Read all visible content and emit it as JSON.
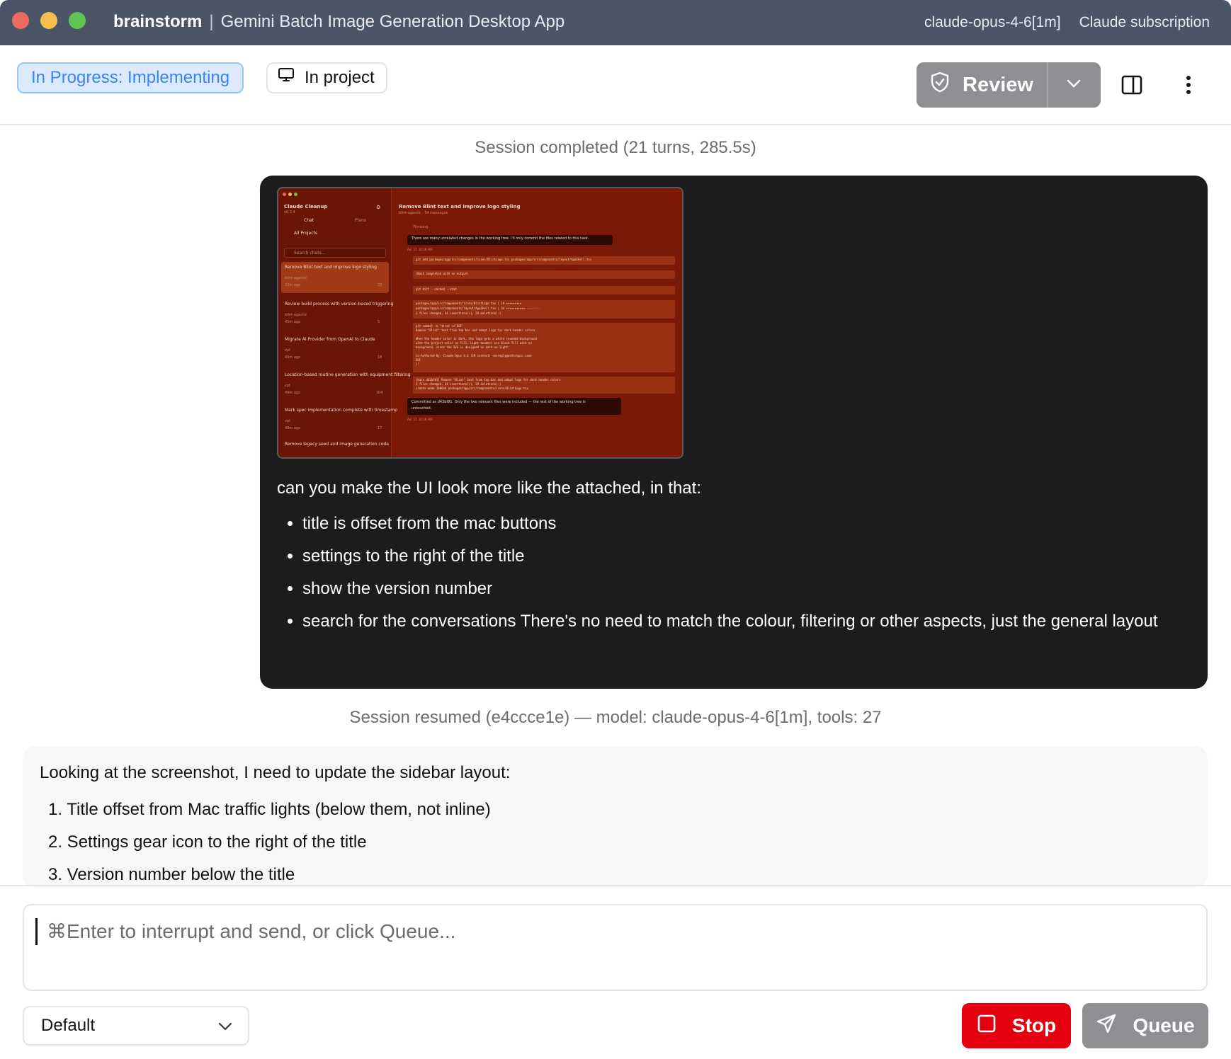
{
  "window": {
    "project": "brainstorm",
    "separator": "|",
    "app_title": "Gemini Batch Image Generation Desktop App",
    "model": "claude-opus-4-6[1m]",
    "plan": "Claude subscription"
  },
  "toolbar": {
    "status": "In Progress: Implementing",
    "location": "In project",
    "review_label": "Review",
    "icons": {
      "location": "monitor-icon",
      "review": "shield-check-icon",
      "caret": "chevron-down-icon",
      "panel": "sidebar-panel-icon",
      "more": "more-vertical-icon"
    }
  },
  "chat": {
    "session_completed": "Session completed (21 turns, 285.5s)",
    "user_message": {
      "intro": "can you make the UI look more like the attached, in that:",
      "bullets": [
        "title is offset from the mac buttons",
        "settings to the right of the title",
        "show the version number",
        "search for the conversations There's no need to match the colour, filtering or other aspects, just the general layout"
      ],
      "attachment": {
        "app_name": "Claude Cleanup",
        "version": "v0.3.4",
        "tab_chat": "Chat",
        "tab_plans": "Plans",
        "filter": "All Projects",
        "search_placeholder": "Search chats...",
        "chats": [
          {
            "title": "Remove Blint text and improve logo styling",
            "project": "blint-agentic",
            "age": "22m ago",
            "count": "23"
          },
          {
            "title": "Review build process with version-based triggering",
            "project": "blint-agentic",
            "age": "45m ago",
            "count": "5"
          },
          {
            "title": "Migrate AI Provider from OpenAI to Claude",
            "project": "vpt",
            "age": "49m ago",
            "count": "18"
          },
          {
            "title": "Location-based routine generation with equipment filtering",
            "project": "vpt",
            "age": "49m ago",
            "count": "104"
          },
          {
            "title": "Mark spec implementation complete with timestamp",
            "project": "vpt",
            "age": "49m ago",
            "count": "17"
          },
          {
            "title": "Remove legacy seed and image generation code",
            "project": "",
            "age": "",
            "count": ""
          }
        ],
        "main_title": "Remove Blint text and improve logo styling",
        "main_meta": "blint-agentic · 54 messages",
        "thinking": "Thinking",
        "msg1": "There are many unrelated changes in the working tree. I'll only commit the files related to this task.",
        "time1": "Apr 17, 10:36 AM",
        "cmd1": "git add packages/app/src/components/icons/BlintLogo.tsx packages/app/src/components/layout/AppShell.tsx",
        "out1": "(Bash completed with no output)",
        "cmd2": "git diff --cached --stat",
        "out2a": "packages/app/src/components/icons/BlintLogo.tsx | 19 +++++++++",
        "out2b": "packages/app/src/components/layout/AppShell.tsx | 54 +++++++++++---------",
        "out2c": "2 files changed, 44 insertions(+), 29 deletions(-)",
        "commit1": "git commit -m \"$(cat <<'EOF'",
        "commit2": "Remove \"Blint\" text from top bar and adapt logo for dark header colors",
        "commit3": "When the header color is dark, the logo gets a white rounded background",
        "commit4": "with the project color as fill. Light headers use black fill with no",
        "commit5": "background, since the SVG is designed as dark-on-light.",
        "commit6": "Co-Authored-By: Claude Opus 4.6 (1M context) <noreply@anthropic.com>",
        "commit7": "EOF",
        "commit8": ")\"",
        "res1": "[main d43bf81] Remove \"Blint\" text from top bar and adapt logo for dark header colors",
        "res2": "2 files changed, 44 insertions(+), 29 deletions(-)",
        "res3": "create mode 100644 packages/app/src/components/icons/BlintLogo.tsx",
        "msg2a": "Committed as d43bf81. Only the two relevant files were included — the rest of the working tree is",
        "msg2b": "untouched.",
        "time2": "Apr 17, 10:36 AM"
      }
    },
    "session_resumed": "Session resumed (e4ccce1e) — model: claude-opus-4-6[1m], tools: 27",
    "assistant_message": {
      "intro": "Looking at the screenshot, I need to update the sidebar layout:",
      "items": [
        "1. Title offset from Mac traffic lights (below them, not inline)",
        "2. Settings gear icon to the right of the title",
        "3. Version number below the title"
      ]
    }
  },
  "composer": {
    "placeholder": "⌘Enter to interrupt and send, or click Queue...",
    "mode": "Default",
    "stop_label": "Stop",
    "queue_label": "Queue"
  },
  "colors": {
    "titlebar": "#4a5567",
    "status_bg": "#dbeafe",
    "status_text": "#3b82f6",
    "stop": "#e5000f",
    "disabled": "#8e8e93",
    "user_bubble": "#1c1c1e"
  }
}
